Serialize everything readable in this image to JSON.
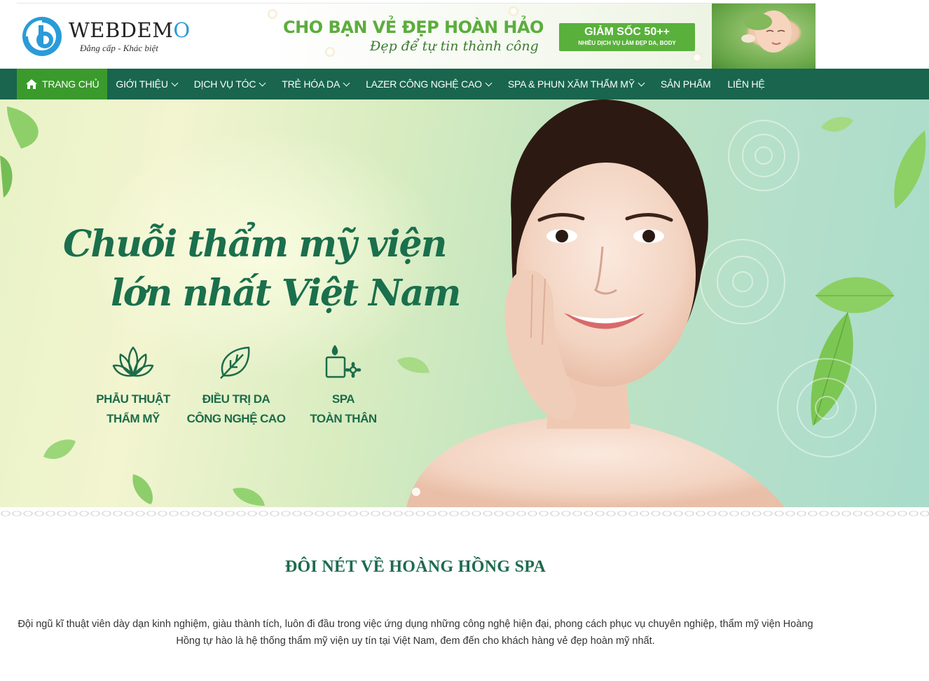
{
  "header": {
    "logo_name_main": "WEBDEM",
    "logo_name_accent": "O",
    "logo_slogan": "Đẳng cấp - Khác biệt",
    "banner": {
      "title": "CHO BẠN VẺ ĐẸP HOÀN HẢO",
      "subtitle": "Đẹp để tự tin thành công",
      "badge_main": "GIẢM SỐC 50++",
      "badge_sub": "NHIỀU DỊCH VỤ LÀM ĐẸP DA, BODY"
    }
  },
  "nav": {
    "items": [
      {
        "label": "TRANG CHỦ",
        "icon": "home-icon",
        "active": true
      },
      {
        "label": "GIỚI THIỆU",
        "dropdown": true
      },
      {
        "label": "DỊCH VỤ TÓC",
        "dropdown": true
      },
      {
        "label": "TRẺ HÓA DA",
        "dropdown": true
      },
      {
        "label": "LAZER CÔNG NGHỆ CAO",
        "dropdown": true
      },
      {
        "label": "SPA & PHUN XĂM THẨM MỸ",
        "dropdown": true
      },
      {
        "label": "SẢN PHẨM"
      },
      {
        "label": "LIÊN HỆ"
      }
    ],
    "color": "#19654d",
    "active_color": "#3a9a2c"
  },
  "hero": {
    "title_line1": "Chuỗi thẩm mỹ viện",
    "title_line2": "lớn nhất Việt Nam",
    "features": [
      {
        "icon": "lotus-icon",
        "line1": "PHẪU THUẬT",
        "line2": "THẨM MỸ"
      },
      {
        "icon": "leaf-icon",
        "line1": "ĐIỀU TRỊ DA",
        "line2": "CÔNG NGHỆ CAO"
      },
      {
        "icon": "candle-flower-icon",
        "line1": "SPA",
        "line2": "TOÀN THÂN"
      }
    ]
  },
  "about": {
    "title": "ĐÔI NÉT VỀ HOÀNG HỒNG SPA",
    "text_line1": "Đội ngũ kĩ thuật viên dày dạn kinh nghiệm, giàu thành tích, luôn đi đầu trong việc ứng dụng những công nghệ hiện đại, phong cách phục vụ chuyên nghiệp, thẩm mỹ viện Hoàng",
    "text_line2": "Hồng tự hào là hệ thống thẩm mỹ viện uy tín tại Việt Nam, đem đến cho khách hàng vẻ đẹp hoàn mỹ nhất."
  }
}
